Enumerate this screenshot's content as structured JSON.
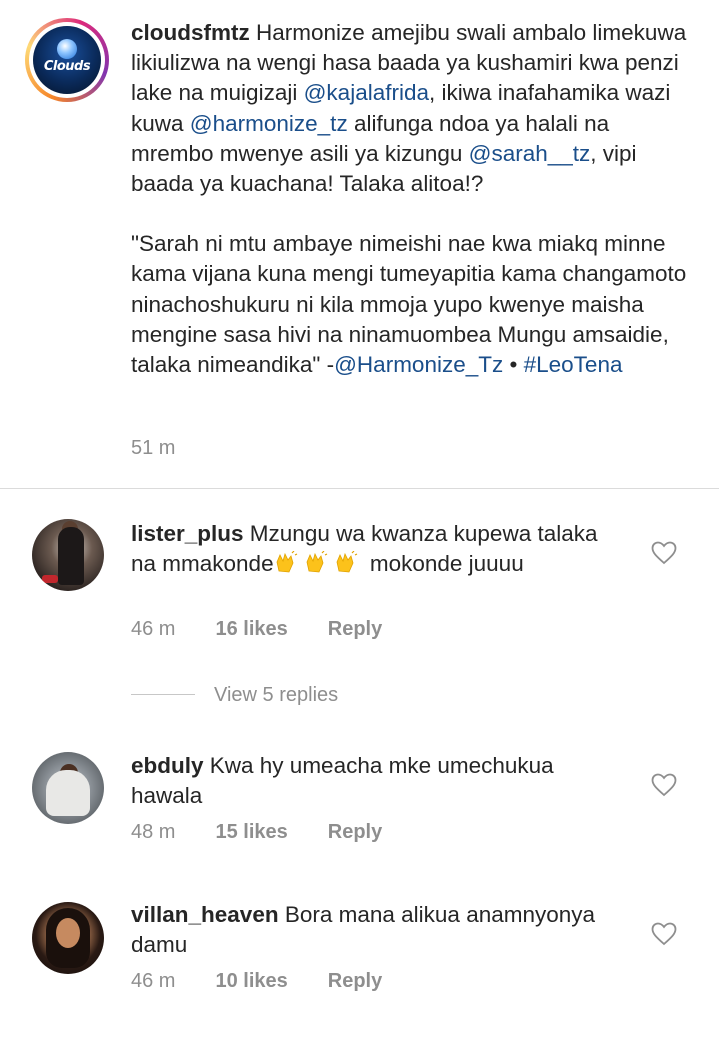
{
  "post": {
    "username": "cloudsfmtz",
    "avatar_logo_text": "Clouds",
    "caption_p1_a": "Harmonize amejibu swali ambalo limekuwa likiulizwa na wengi hasa baada ya kushamiri kwa penzi lake na muigizaji ",
    "mention_1": "@kajalafrida",
    "caption_p1_b": ", ikiwa inafahamika wazi kuwa ",
    "mention_2": "@harmonize_tz",
    "caption_p1_c": " alifunga ndoa ya halali na mrembo mwenye asili ya kizungu ",
    "mention_3": "@sarah__tz",
    "caption_p1_d": ", vipi baada ya kuachana! Talaka alitoa!?",
    "caption_p2_a": "\"Sarah ni mtu ambaye nimeishi nae kwa miakq minne kama vijana kuna mengi tumeyapitia kama changamoto ninachoshukuru ni kila mmoja yupo kwenye maisha mengine sasa hivi na ninamuombea Mungu amsaidie, talaka nimeandika\" -",
    "mention_4": "@Harmonize_Tz",
    "separator": " • ",
    "hashtag": "#LeoTena",
    "time": "51 m"
  },
  "comments": [
    {
      "username": "lister_plus",
      "text": " Mzungu wa kwanza kupewa talaka na mmakonde",
      "text_after_emoji": " mokonde juuuu",
      "time": "46 m",
      "likes": "16 likes",
      "reply": "Reply",
      "view_replies": "View 5 replies"
    },
    {
      "username": "ebduly",
      "text": " Kwa hy umeacha mke umechukua hawala",
      "time": "48 m",
      "likes": "15 likes",
      "reply": "Reply"
    },
    {
      "username": "villan_heaven",
      "text": " Bora mana alikua anamnyonya damu",
      "time": "46 m",
      "likes": "10 likes",
      "reply": "Reply"
    }
  ],
  "icons": {
    "heart": "heart-outline-icon",
    "clap": "clapping-hands-emoji"
  },
  "colors": {
    "mention": "#1a4e8a",
    "muted": "#8e8e8e",
    "text": "#262626"
  }
}
